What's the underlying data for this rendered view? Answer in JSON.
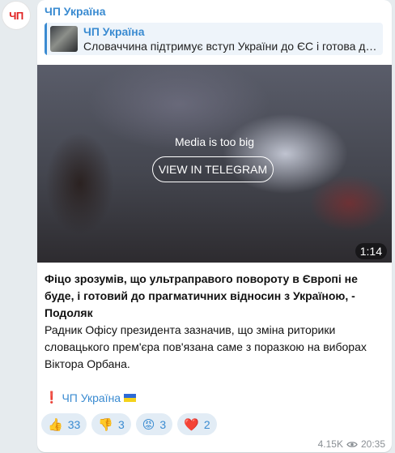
{
  "channel": {
    "avatar_text": "ЧП",
    "name": "ЧП Україна"
  },
  "reply": {
    "title": "ЧП Україна",
    "text": "Словаччина підтримує вступ України до ЄС і готова д…"
  },
  "media": {
    "message": "Media is too big",
    "button_label": "VIEW IN TELEGRAM",
    "duration": "1:14"
  },
  "post": {
    "headline": "Фіцо зрозумів, що ультраправого повороту в Європі не буде, і готовий до прагматичних відносин з Україною, - Подоляк",
    "body": "Радник Офісу президента зазначив, що зміна риторики словацького прем'єра пов'язана саме з поразкою на виборах Віктора Орбана.",
    "signature_mark": "❗",
    "signature_text": "ЧП Україна"
  },
  "reactions": [
    {
      "emoji": "👍",
      "count": "33"
    },
    {
      "emoji": "👎",
      "count": "3"
    },
    {
      "emoji": "😡",
      "count": "3"
    },
    {
      "emoji": "❤️",
      "count": "2"
    }
  ],
  "meta": {
    "views": "4.15K",
    "time": "20:35"
  },
  "colors": {
    "accent": "#3a8bd1",
    "background": "#e6ebee",
    "reaction_bg": "#e2ecf5",
    "avatar_text": "#e02020"
  }
}
